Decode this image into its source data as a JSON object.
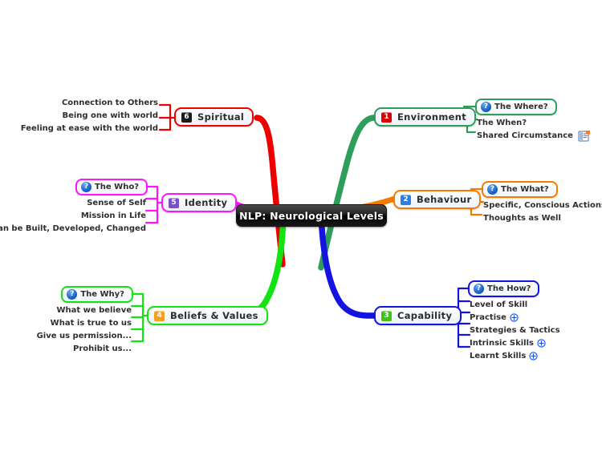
{
  "central": {
    "title": "NLP: Neurological Levels"
  },
  "branches": [
    {
      "id": "environment",
      "label": "Environment",
      "number": "1",
      "badge_color": "#d80000",
      "border_color": "#2e9e5b",
      "side": "right",
      "subs": [
        {
          "text": "The Where?",
          "boxed": true,
          "icon": "question-icon"
        },
        {
          "text": "The When?",
          "boxed": false,
          "icon": ""
        },
        {
          "text": "Shared Circumstance",
          "boxed": false,
          "icon": "note-icon"
        }
      ]
    },
    {
      "id": "behaviour",
      "label": "Behaviour",
      "number": "2",
      "badge_color": "#2b7fe0",
      "border_color": "#f57c00",
      "side": "right",
      "subs": [
        {
          "text": "The What?",
          "boxed": true,
          "icon": "question-icon"
        },
        {
          "text": "Specific, Conscious Actions",
          "boxed": false,
          "icon": ""
        },
        {
          "text": "Thoughts as Well",
          "boxed": false,
          "icon": ""
        }
      ]
    },
    {
      "id": "capability",
      "label": "Capability",
      "number": "3",
      "badge_color": "#3fc21a",
      "border_color": "#1414e0",
      "side": "right",
      "subs": [
        {
          "text": "The How?",
          "boxed": true,
          "icon": "question-icon"
        },
        {
          "text": "Level of Skill",
          "boxed": false,
          "icon": ""
        },
        {
          "text": "Practise",
          "boxed": false,
          "icon": "plus-icon"
        },
        {
          "text": "Strategies & Tactics",
          "boxed": false,
          "icon": ""
        },
        {
          "text": "Intrinsic Skills",
          "boxed": false,
          "icon": "plus-icon"
        },
        {
          "text": "Learnt Skills",
          "boxed": false,
          "icon": "plus-icon"
        }
      ]
    },
    {
      "id": "beliefs-values",
      "label": "Beliefs & Values",
      "number": "4",
      "badge_color": "#f5a020",
      "border_color": "#12e312",
      "side": "left",
      "subs": [
        {
          "text": "The Why?",
          "boxed": true,
          "icon": "question-icon"
        },
        {
          "text": "What we believe",
          "boxed": false,
          "icon": ""
        },
        {
          "text": "What is true to us",
          "boxed": false,
          "icon": ""
        },
        {
          "text": "Give us permission...",
          "boxed": false,
          "icon": ""
        },
        {
          "text": "Prohibit us...",
          "boxed": false,
          "icon": ""
        }
      ]
    },
    {
      "id": "identity",
      "label": "Identity",
      "number": "5",
      "badge_color": "#7b4fd0",
      "border_color": "#ff14ff",
      "side": "left",
      "subs": [
        {
          "text": "The Who?",
          "boxed": true,
          "icon": "question-icon"
        },
        {
          "text": "Sense of Self",
          "boxed": false,
          "icon": ""
        },
        {
          "text": "Mission in Life",
          "boxed": false,
          "icon": ""
        },
        {
          "text": "Can be Built, Developed, Changed",
          "boxed": false,
          "icon": ""
        }
      ]
    },
    {
      "id": "spiritual",
      "label": "Spiritual",
      "number": "6",
      "badge_color": "#1c1c1c",
      "border_color": "#ee0000",
      "side": "left",
      "subs": [
        {
          "text": "Connection to Others",
          "boxed": false,
          "icon": ""
        },
        {
          "text": "Being one with world",
          "boxed": false,
          "icon": ""
        },
        {
          "text": "Feeling at ease with the world",
          "boxed": false,
          "icon": ""
        }
      ]
    }
  ],
  "icons": {
    "question": "?",
    "plus": "+"
  },
  "colors": {
    "background": "#ffffff",
    "central_text": "#ffffff",
    "sub_text": "#2f2f2f"
  }
}
